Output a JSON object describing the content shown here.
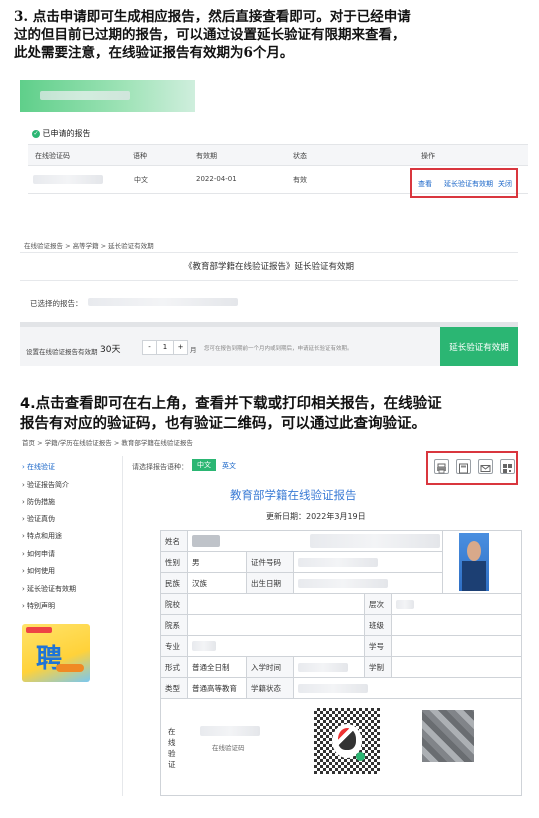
{
  "step3": {
    "lines": [
      "3. 点击申请即可生成相应报告，然后直接查看即可。对于已经申请",
      "过的但目前已过期的报告，可以通过设置延长验证有限期来查看，",
      "此处需要注意，在线验证报告有效期为6个月。"
    ]
  },
  "applied": {
    "section_title": "已申请的报告",
    "headers": [
      "在线验证码",
      "语种",
      "有效期",
      "状态",
      "操作"
    ],
    "row": {
      "language": "中文",
      "expiry": "2022-04-01",
      "status": "有效",
      "actions": [
        "查看",
        "延长验证有效期",
        "关闭"
      ]
    }
  },
  "extend": {
    "breadcrumb": "在线验证报告 > 高等学籍 > 延长验证有效期",
    "title": "《教育部学籍在线验证报告》延长验证有效期",
    "selected_label": "已选择的报告：",
    "period_label": "设置在线验证报告有效期",
    "period_value": "30天",
    "stepper_minus": "-",
    "stepper_value": "1",
    "stepper_plus": "+",
    "unit": "月",
    "hint": "您可在报告到期前一个月内或到期后，申请延长验证有效期。",
    "button": "延长验证有效期"
  },
  "step4": {
    "lines": [
      "4.点击查看即可在右上角，查看并下载或打印相关报告，在线验证",
      "报告有对应的验证码，也有验证二维码，可以通过此查询验证。"
    ]
  },
  "report": {
    "breadcrumb": "首页 > 学籍/学历在线验证报告 > 教育部学籍在线验证报告",
    "lang_label": "请选择报告语种：",
    "lang_cn": "中文",
    "lang_en": "英文",
    "sidebar": [
      "在线验证",
      "验证报告简介",
      "防伪措施",
      "验证真伪",
      "特点和用途",
      "如何申请",
      "如何使用",
      "延长验证有效期",
      "特别声明"
    ],
    "ad_text": "聘",
    "title": "教育部学籍在线验证报告",
    "update_date": "更新日期：2022年3月19日",
    "labels": {
      "name": "姓名",
      "gender": "性别",
      "cert_no": "证件号码",
      "ethnicity": "民族",
      "birth": "出生日期",
      "school": "院校",
      "level": "层次",
      "dept": "院系",
      "class": "班级",
      "major": "专业",
      "student_no": "学号",
      "form": "形式",
      "enroll": "入学时间",
      "duration": "学制",
      "type": "类型",
      "status": "学籍状态",
      "verify": "在线验证码"
    },
    "values": {
      "gender": "男",
      "ethnicity": "汉族",
      "form": "普通全日制",
      "type": "普通高等教育"
    },
    "verify_side_label": "在线验证",
    "verify_inner": "在线验证码"
  },
  "colors": {
    "accent": "#1a66c8",
    "green": "#2bb673",
    "red": "#d9363e",
    "blue_title": "#3a7bd5"
  }
}
